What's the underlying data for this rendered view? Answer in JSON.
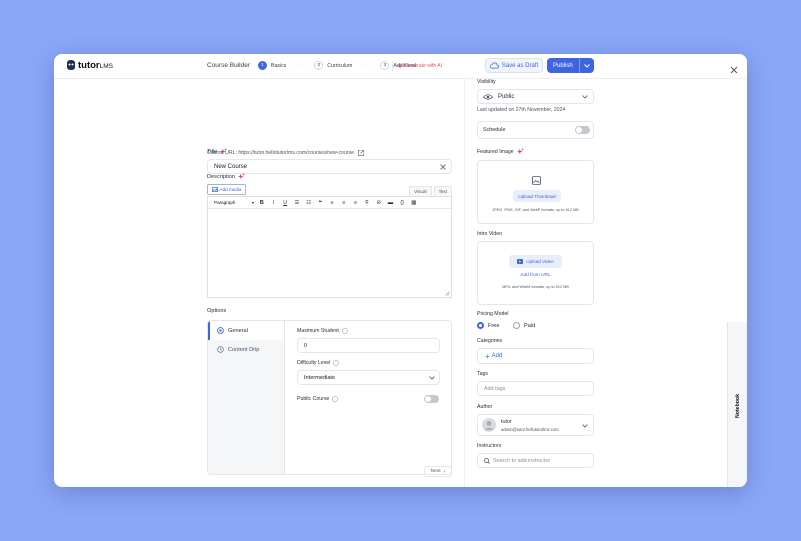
{
  "header": {
    "logo_bold": "tutor",
    "logo_light": "LMS",
    "builder_title": "Course Builder",
    "steps": [
      {
        "num": "1",
        "label": "Basics"
      },
      {
        "num": "2",
        "label": "Curriculum"
      },
      {
        "num": "3",
        "label": "Additional"
      }
    ],
    "step_separator": "······",
    "ai_label": "Generate with AI",
    "save_draft": "Save as Draft",
    "publish": "Publish"
  },
  "main": {
    "title_label": "Title",
    "title_value": "New Course",
    "course_url": "Course URL: https://tutor.hellotutorlms.com/courses/new-course",
    "description_label": "Description",
    "add_media": "Add media",
    "mode_visual": "Visual",
    "mode_text": "Text",
    "format_select": "Paragraph",
    "options_label": "Options",
    "option_tabs": [
      "General",
      "Content Drip"
    ],
    "max_student_label": "Maximum Student",
    "max_student_value": "0",
    "difficulty_label": "Difficulty Level",
    "difficulty_value": "Intermediate",
    "public_course_label": "Public Course",
    "next_label": "Next"
  },
  "sidebar": {
    "visibility_label": "Visibility",
    "visibility_value": "Public",
    "last_updated": "Last updated on 27th November, 2024",
    "schedule_label": "Schedule",
    "featured_image_label": "Featured Image",
    "upload_thumbnail": "Upload Thumbnail",
    "thumbnail_hint": "JPEG, PNG, GIF, and WebP formats, up to 512 MB",
    "intro_video_label": "Intro Video",
    "upload_video": "Upload Video",
    "add_from_url": "Add from URL",
    "video_hint": "MP4, and WebM formats, up to 512 MB",
    "pricing_label": "Pricing Model",
    "pricing_options": [
      "Free",
      "Paid"
    ],
    "categories_label": "Categories",
    "add_category": "Add",
    "tags_label": "Tags",
    "tags_placeholder": "Add tags",
    "author_label": "Author",
    "author_name": "tutor",
    "author_email": "admin@tutor.hellotutorlms.com",
    "instructors_label": "Instructors",
    "instructor_placeholder": "Search to add instructor",
    "notebook": "Notebook"
  },
  "colors": {
    "accent": "#3e64de",
    "background": "#8aa6f7",
    "ai": "#e0525f"
  }
}
